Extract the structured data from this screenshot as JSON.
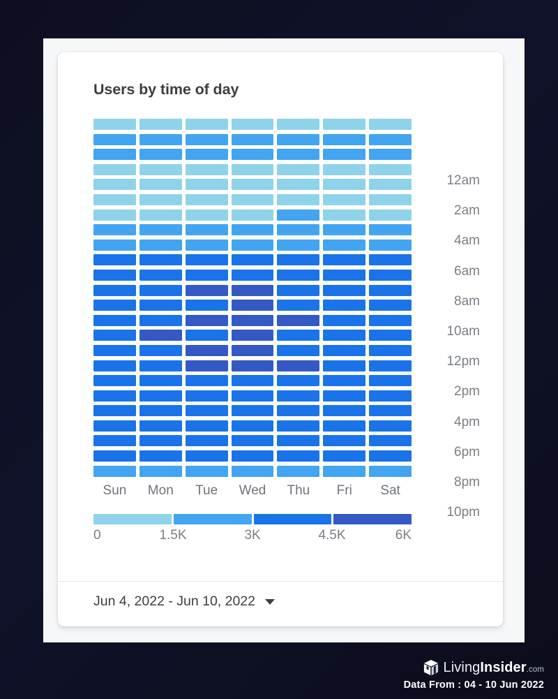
{
  "card": {
    "title": "Users by time of day",
    "footer_range": "Jun 4, 2022 - Jun 10, 2022"
  },
  "branding": {
    "name_light": "Living",
    "name_bold": "Insider",
    "tld": ".com",
    "data_from": "Data From :  04 - 10 Jun 2022"
  },
  "palette": {
    "band1": "#8FD3EA",
    "band2": "#43A4F0",
    "band3": "#1A73E8",
    "band4": "#3459C4",
    "background": "#0d0f20",
    "panel": "#f6f7f9",
    "card": "#ffffff"
  },
  "chart_data": {
    "type": "heatmap",
    "title": "Users by time of day",
    "xlabel": "",
    "ylabel": "",
    "grid": false,
    "legend_position": "bottom",
    "categories": [
      "Sun",
      "Mon",
      "Tue",
      "Wed",
      "Thu",
      "Fri",
      "Sat"
    ],
    "hours": [
      "12am",
      "1am",
      "2am",
      "3am",
      "4am",
      "5am",
      "6am",
      "7am",
      "8am",
      "9am",
      "10am",
      "11am",
      "12pm",
      "1pm",
      "2pm",
      "3pm",
      "4pm",
      "5pm",
      "6pm",
      "7pm",
      "8pm",
      "9pm",
      "10pm",
      "11pm"
    ],
    "hour_tick_labels": [
      {
        "index": 0,
        "label": "12am"
      },
      {
        "index": 2,
        "label": "2am"
      },
      {
        "index": 4,
        "label": "4am"
      },
      {
        "index": 6,
        "label": "6am"
      },
      {
        "index": 8,
        "label": "8am"
      },
      {
        "index": 10,
        "label": "10am"
      },
      {
        "index": 12,
        "label": "12pm"
      },
      {
        "index": 14,
        "label": "2pm"
      },
      {
        "index": 16,
        "label": "4pm"
      },
      {
        "index": 18,
        "label": "6pm"
      },
      {
        "index": 20,
        "label": "8pm"
      },
      {
        "index": 22,
        "label": "10pm"
      }
    ],
    "legend": {
      "bands": [
        "#8FD3EA",
        "#43A4F0",
        "#1A73E8",
        "#3459C4"
      ],
      "ticks": [
        "0",
        "1.5K",
        "3K",
        "4.5K",
        "6K"
      ],
      "tick_values": [
        0,
        1500,
        3000,
        4500,
        6000
      ],
      "range": [
        0,
        6000
      ]
    },
    "zlim": [
      0,
      6000
    ],
    "bins": [
      {
        "band": 1,
        "color": "#8FD3EA",
        "range": [
          0,
          1500
        ]
      },
      {
        "band": 2,
        "color": "#43A4F0",
        "range": [
          1500,
          3000
        ]
      },
      {
        "band": 3,
        "color": "#1A73E8",
        "range": [
          3000,
          4500
        ]
      },
      {
        "band": 4,
        "color": "#3459C4",
        "range": [
          4500,
          6000
        ]
      }
    ],
    "values": [
      [
        1100,
        1150,
        1200,
        1180,
        1120,
        1100,
        1080
      ],
      [
        2300,
        2350,
        2400,
        2380,
        2320,
        2300,
        2280
      ],
      [
        2250,
        2300,
        2350,
        2330,
        2270,
        2250,
        2230
      ],
      [
        1300,
        1350,
        1400,
        1380,
        1320,
        1300,
        1280
      ],
      [
        1250,
        1300,
        1350,
        1330,
        1270,
        1250,
        1230
      ],
      [
        1200,
        1250,
        1300,
        1280,
        1220,
        1200,
        1180
      ],
      [
        1400,
        1450,
        1420,
        1440,
        2600,
        1430,
        1410
      ],
      [
        2500,
        2550,
        2600,
        2580,
        2520,
        2500,
        2480
      ],
      [
        2700,
        2750,
        2800,
        2780,
        2720,
        2700,
        2680
      ],
      [
        3600,
        3700,
        3800,
        3750,
        3650,
        3600,
        3550
      ],
      [
        3800,
        3900,
        4000,
        3950,
        3850,
        3800,
        3750
      ],
      [
        3900,
        4000,
        4800,
        4900,
        3950,
        3900,
        3850
      ],
      [
        3850,
        3950,
        4100,
        4850,
        3900,
        3850,
        3800
      ],
      [
        3900,
        4000,
        4900,
        4950,
        4800,
        3900,
        3850
      ],
      [
        3950,
        4850,
        4200,
        4900,
        4000,
        3950,
        3900
      ],
      [
        4000,
        4100,
        4850,
        4950,
        4100,
        4000,
        3950
      ],
      [
        4050,
        4150,
        4900,
        5000,
        4900,
        4050,
        4000
      ],
      [
        3900,
        4000,
        4100,
        4150,
        4000,
        3900,
        3850
      ],
      [
        3800,
        3900,
        4000,
        4050,
        3900,
        3800,
        3750
      ],
      [
        3700,
        3800,
        3900,
        3950,
        3800,
        3700,
        3650
      ],
      [
        3600,
        3700,
        3800,
        3850,
        3700,
        3600,
        3550
      ],
      [
        3500,
        3600,
        3700,
        3750,
        3600,
        3500,
        3450
      ],
      [
        3400,
        3500,
        3600,
        3650,
        3500,
        3400,
        3350
      ],
      [
        2500,
        2600,
        2700,
        2650,
        2550,
        2500,
        2450
      ]
    ]
  }
}
